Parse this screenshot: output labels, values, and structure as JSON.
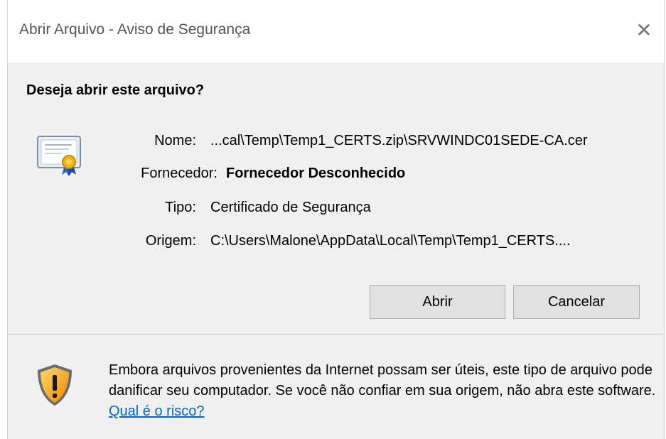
{
  "window": {
    "title": "Abrir Arquivo - Aviso de Segurança",
    "close_glyph": "✕"
  },
  "question": "Deseja abrir este arquivo?",
  "fields": {
    "name_label": "Nome:",
    "name_value": "...cal\\Temp\\Temp1_CERTS.zip\\SRVWINDC01SEDE-CA.cer",
    "publisher_label": "Fornecedor:",
    "publisher_value": "Fornecedor Desconhecido",
    "type_label": "Tipo:",
    "type_value": "Certificado de Segurança",
    "origin_label": "Origem:",
    "origin_value": "C:\\Users\\Malone\\AppData\\Local\\Temp\\Temp1_CERTS...."
  },
  "buttons": {
    "open": "Abrir",
    "cancel": "Cancelar"
  },
  "warning": {
    "text": "Embora arquivos provenientes da Internet possam ser úteis, este tipo de arquivo pode danificar seu computador. Se você não confiar em sua origem, não abra este software.",
    "link": "Qual é o risco?"
  },
  "icons": {
    "certificate": "certificate-icon",
    "shield": "shield-warning-icon",
    "close": "close-icon"
  },
  "colors": {
    "link": "#0066cc",
    "dialog_bg": "#f0f0f0",
    "button_bg": "#e1e1e1",
    "shield": "#f5a623"
  }
}
